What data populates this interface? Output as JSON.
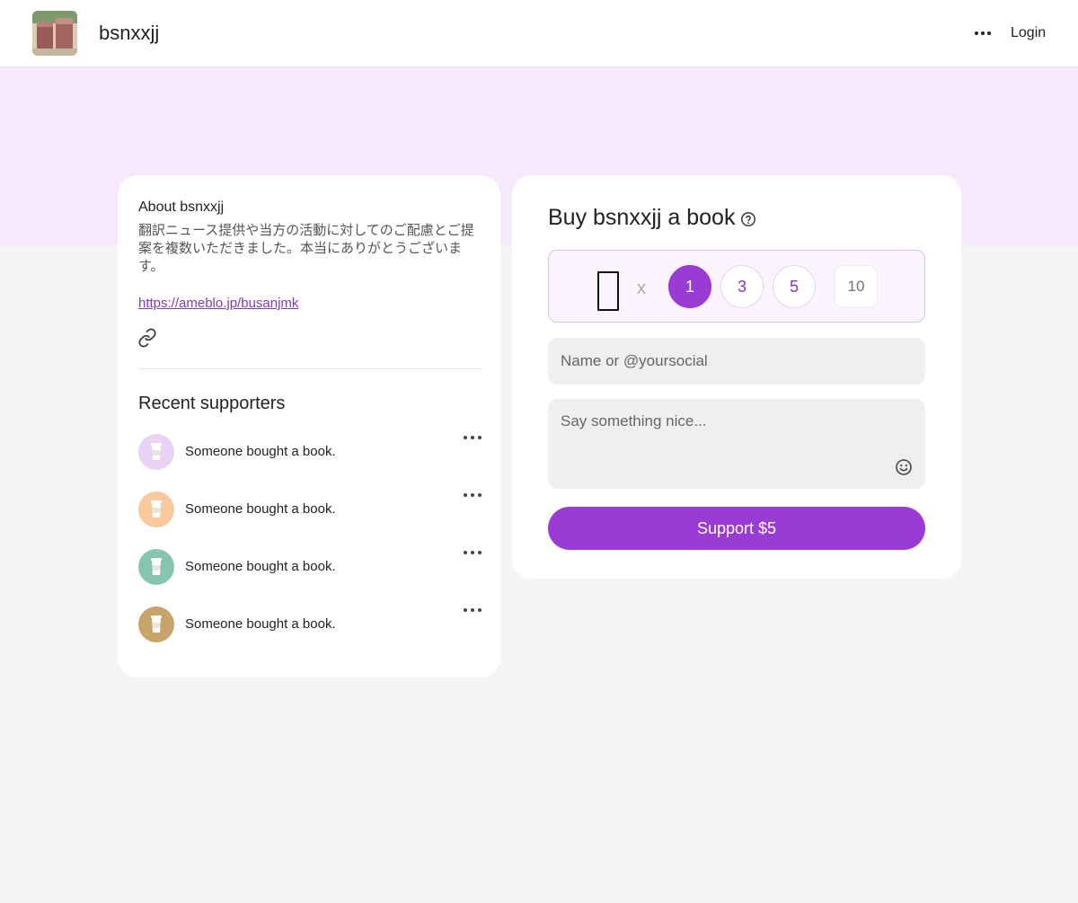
{
  "header": {
    "site_name": "bsnxxjj",
    "login_label": "Login"
  },
  "about": {
    "title": "About bsnxxjj",
    "text": "翻訳ニュース提供や当方の活動に対してのご配慮とご提案を複数いただきました。本当にありがとうございます。",
    "link": "https://ameblo.jp/busanjmk"
  },
  "recent": {
    "title": "Recent supporters",
    "items": [
      {
        "text": "Someone bought a book.",
        "avatar_color": "#e8d3f5"
      },
      {
        "text": "Someone bought a book.",
        "avatar_color": "#f7c99c"
      },
      {
        "text": "Someone bought a book.",
        "avatar_color": "#86c6b1"
      },
      {
        "text": "Someone bought a book.",
        "avatar_color": "#c8a46a"
      }
    ]
  },
  "buy": {
    "title": "Buy bsnxxjj a book",
    "times": "x",
    "quantities": [
      "1",
      "3",
      "5"
    ],
    "selected_quantity": "1",
    "custom_quantity_placeholder": "10",
    "name_placeholder": "Name or @yoursocial",
    "message_placeholder": "Say something nice...",
    "support_label": "Support $5"
  },
  "colors": {
    "accent": "#9a3bd6",
    "banner": "#f5e9fb",
    "link": "#7a3fb0"
  }
}
